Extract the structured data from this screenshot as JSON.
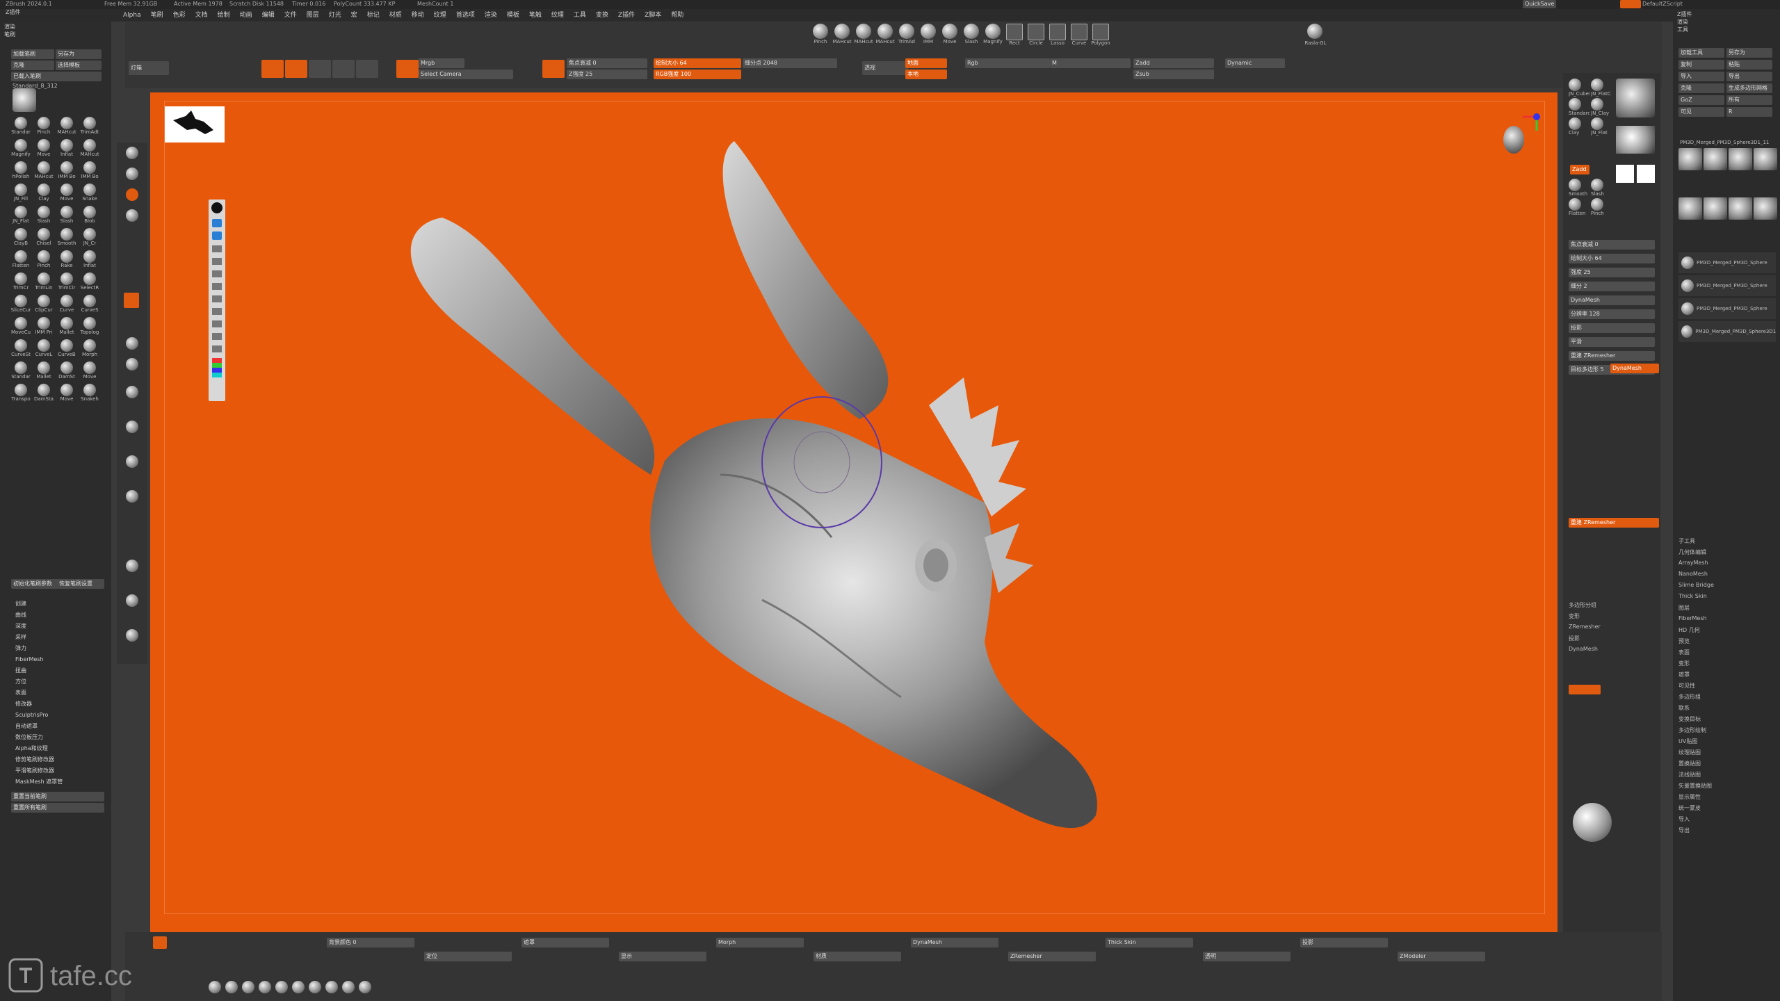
{
  "title_bar": {
    "app": "ZBrush 2024.0.1",
    "items": [
      "Free Mem 32.91GB",
      "Active Mem 1978",
      "Scratch Disk 11548",
      "Timer 0.016",
      "PolyCount 333.477 KP",
      "MeshCount 1"
    ],
    "right": [
      "QuickSave",
      "DefaultZScript"
    ]
  },
  "menu": [
    "Alpha",
    "笔刷",
    "色彩",
    "文档",
    "绘制",
    "动画",
    "编辑",
    "文件",
    "图层",
    "灯光",
    "宏",
    "标记",
    "材质",
    "移动",
    "纹理",
    "首选项",
    "渲染",
    "模板",
    "笔触",
    "纹理",
    "工具",
    "变换",
    "Z插件",
    "Z脚本",
    "帮助"
  ],
  "left_top_menu": [
    "Z插件",
    "渲染",
    "笔刷"
  ],
  "brush_panel": {
    "current": "Standard_8_312",
    "header_buttons": [
      "加载笔刷",
      "另存为",
      "克隆",
      "选择模板",
      "已载入笔刷"
    ],
    "brushes": [
      "Standar",
      "Pinch",
      "MAHcut",
      "TrimAdt",
      "Magnify",
      "Move",
      "Inflat",
      "MAHcut",
      "hPolish",
      "MAHcut",
      "IMM Bo",
      "IMM Bo",
      "JN_Fill",
      "Clay",
      "Move",
      "Snake",
      "JN_Flat",
      "Slash",
      "Slash",
      "Blob",
      "ClayB",
      "Chisel",
      "Smooth",
      "JN_Cr",
      "Flatten",
      "Pinch",
      "Rake",
      "Inflat",
      "TrimCr",
      "TrimLin",
      "TrimCir",
      "SelectR",
      "SliceCur",
      "ClipCur",
      "Curve",
      "CurveS",
      "MoveCu",
      "IMM Pri",
      "Mallet",
      "Topolog",
      "CurveSt",
      "CurveL",
      "CurveB",
      "Morph",
      "Standar",
      "Mallet",
      "DamSt",
      "Move",
      "Transpo",
      "DamSta",
      "Move",
      "Snakeh"
    ],
    "footer_buttons": [
      "初始化笔刷参数",
      "恢复笔刷设置"
    ],
    "sections": [
      "创建",
      "曲线",
      "深度",
      "采样",
      "弹力",
      "FiberMesh",
      "扭曲",
      "方位",
      "表面",
      "修改器",
      "SculptrisPro",
      "自动遮罩",
      "数位板压力",
      "Alpha和纹理",
      "修剪笔刷修改器",
      "平滑笔刷修改器",
      "MaskMesh 遮罩管"
    ],
    "bottom_buttons": [
      "重置当前笔刷",
      "重置所有笔刷"
    ]
  },
  "top_toolbar": {
    "light_box": "灯箱",
    "draw_modes": [
      "Edit",
      "Draw",
      "Move",
      "Scale",
      "Rotate"
    ],
    "mrgb": [
      "Mrgb",
      "Rgb",
      "M"
    ],
    "zadd": "Zadd",
    "zsub": "Zsub",
    "focal_shift": "焦点衰减 0",
    "draw_size": "绘制大小 64",
    "dynamic": "Dynamic",
    "z_intensity": "Z强度 25",
    "rgb_intensity": "RGB强度 100",
    "divide": "细分点 2048",
    "camera": "Select Camera",
    "perspective": "透视",
    "floor": "地面",
    "local": "本地",
    "brushes": [
      "Pinch",
      "MAHcut",
      "MAHcut",
      "MAHcut",
      "TrimAd",
      "IMM",
      "Move",
      "Slash",
      "Magnify",
      "Rect",
      "Circle",
      "Lasso",
      "Curve",
      "Polygon"
    ],
    "right_brush": "Rasla-GL"
  },
  "canvas": {
    "bg_color": "#e8580a",
    "mesh_label": "PM3D_Merged"
  },
  "right_panel_1": {
    "materials": [
      "JN_CubeR",
      "JN_FlatC",
      "Standard",
      "JN_Clay",
      "Clay",
      "JN_Flat",
      "Smooth",
      "Slash",
      "Flatten",
      "Pinch"
    ],
    "color_swatch": [
      "#ffffff",
      "#222222"
    ],
    "values": [
      "焦点衰减 0",
      "绘制大小 64",
      "强度 25",
      "细分 2",
      "DynaMesh",
      "分辨率 128",
      "投影",
      "平滑",
      "重建 ZRemesher",
      "目标多边形 5"
    ],
    "sections": [
      "多边形分组",
      "变形",
      "ZRemesher",
      "投影",
      "DynaMesh"
    ]
  },
  "right_panel_2": {
    "header": [
      "Z插件",
      "渲染",
      "工具"
    ],
    "tool_buttons": [
      "加载工具",
      "另存为",
      "复制",
      "粘贴",
      "导入",
      "导出",
      "克隆",
      "生成多边形网格",
      "GoZ",
      "所有",
      "可见",
      "R"
    ],
    "current_tool": "PM3D_Merged_PM3D_Sphere3D1_11",
    "subtools": [
      "PM3D_Merged_PM3D_Sphere",
      "PM3D_Merged_PM3D_Sphere",
      "PM3D_Merged_PM3D_Sphere",
      "PM3D_Merged_PM3D_Sphere3D1_13"
    ],
    "sections": [
      "子工具",
      "几何体编辑",
      "ArrayMesh",
      "NanoMesh",
      "Slime Bridge",
      "Thick Skin",
      "图层",
      "FiberMesh",
      "HD 几何",
      "预览",
      "表面",
      "变形",
      "遮罩",
      "可见性",
      "多边形组",
      "联系",
      "变换目标",
      "多边形绘制",
      "UV贴图",
      "纹理贴图",
      "置换贴图",
      "法线贴图",
      "矢量置换贴图",
      "显示属性",
      "统一蒙皮",
      "导入",
      "导出"
    ]
  },
  "bottom_bar": {
    "items": [
      "背景颜色 0",
      "定位",
      "遮罩",
      "显示",
      "Morph",
      "材质",
      "DynaMesh",
      "ZRemesher",
      "Thick Skin",
      "透明",
      "投影",
      "ZModeler"
    ]
  },
  "watermark": "tafe.cc"
}
